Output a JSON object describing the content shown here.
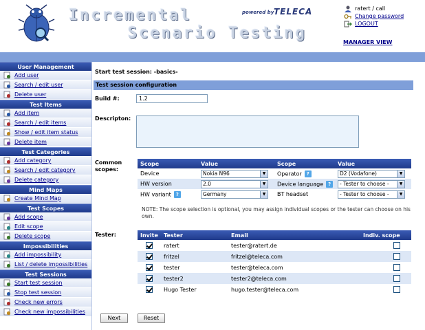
{
  "header": {
    "title_line1": "Incremental",
    "title_line2": "Scenario Testing",
    "powered_by": "powered by",
    "brand": "TELECA",
    "user_info": "ratert / call",
    "change_password": "Change password",
    "logout": "LOGOUT",
    "manager_view": "MANAGER VIEW"
  },
  "sidebar": {
    "sections": [
      {
        "title": "User Management",
        "items": [
          {
            "label": "Add user",
            "icon": "add-user-icon"
          },
          {
            "label": "Search / edit user",
            "icon": "edit-user-icon"
          },
          {
            "label": "Delete user",
            "icon": "delete-user-icon"
          }
        ]
      },
      {
        "title": "Test Items",
        "items": [
          {
            "label": "Add item",
            "icon": "add-item-icon"
          },
          {
            "label": "Search / edit items",
            "icon": "edit-items-icon"
          },
          {
            "label": "Show / edit item status",
            "icon": "item-status-icon"
          },
          {
            "label": "Delete item",
            "icon": "delete-item-icon"
          }
        ]
      },
      {
        "title": "Test Categories",
        "items": [
          {
            "label": "Add category",
            "icon": "add-category-icon"
          },
          {
            "label": "Search / edit category",
            "icon": "edit-category-icon"
          },
          {
            "label": "Delete category",
            "icon": "delete-category-icon"
          }
        ]
      },
      {
        "title": "Mind Maps",
        "items": [
          {
            "label": "Create Mind Map",
            "icon": "mind-map-icon"
          }
        ]
      },
      {
        "title": "Test Scopes",
        "items": [
          {
            "label": "Add scope",
            "icon": "add-scope-icon"
          },
          {
            "label": "Edit scope",
            "icon": "edit-scope-icon"
          },
          {
            "label": "Delete scope",
            "icon": "delete-scope-icon"
          }
        ]
      },
      {
        "title": "Impossibilities",
        "items": [
          {
            "label": "Add impossibility",
            "icon": "add-impossibility-icon"
          },
          {
            "label": "List / delete impossibilities",
            "icon": "warning-icon"
          }
        ]
      },
      {
        "title": "Test Sessions",
        "items": [
          {
            "label": "Start test session",
            "icon": "start-session-icon"
          },
          {
            "label": "Stop test session",
            "icon": "stop-session-icon"
          },
          {
            "label": "Check new errors",
            "icon": "check-errors-icon"
          },
          {
            "label": "Check new impossibilities",
            "icon": "check-impossibilities-icon"
          }
        ]
      }
    ]
  },
  "main": {
    "page_title": "Start test session: -basics-",
    "section_title": "Test session configuration",
    "build_label": "Build #:",
    "build_value": "1.2",
    "description_label": "Descripton:",
    "common_scopes_label": "Common scopes:",
    "scope_headers": [
      "Scope",
      "Value",
      "Scope",
      "Value"
    ],
    "scope_rows": [
      {
        "scope1": "Device",
        "value1": "Nokia N96",
        "help1": false,
        "scope2": "Operator",
        "value2": "D2 (Vodafone)",
        "help2": true
      },
      {
        "scope1": "HW version",
        "value1": "2.0",
        "help1": false,
        "scope2": "Device language",
        "value2": "- Tester to choose -",
        "help2": true
      },
      {
        "scope1": "HW variant",
        "value1": "Germany",
        "help1": true,
        "scope2": "BT headset",
        "value2": "- Tester to choose -",
        "help2": false
      }
    ],
    "note": "NOTE: The scope selection is optional, you may assign individual scopes or the tester can choose on his own.",
    "tester_label": "Tester:",
    "tester_headers": [
      "Invite",
      "Tester",
      "Email",
      "Indiv. scope"
    ],
    "testers": [
      {
        "name": "ratert",
        "email": "tester@ratert.de",
        "invite": true,
        "indiv": false
      },
      {
        "name": "fritzel",
        "email": "fritzel@teleca.com",
        "invite": true,
        "indiv": false
      },
      {
        "name": "tester",
        "email": "tester@teleca.com",
        "invite": true,
        "indiv": false
      },
      {
        "name": "tester2",
        "email": "tester2@teleca.com",
        "invite": true,
        "indiv": false
      },
      {
        "name": "Hugo Tester",
        "email": "hugo.tester@teleca.com",
        "invite": true,
        "indiv": false
      }
    ],
    "next_label": "Next",
    "reset_label": "Reset"
  },
  "colors": {
    "nav_dark": "#29459a",
    "strip": "#7f9fd9",
    "row_alt": "#dde7f6",
    "link": "#00008b"
  }
}
